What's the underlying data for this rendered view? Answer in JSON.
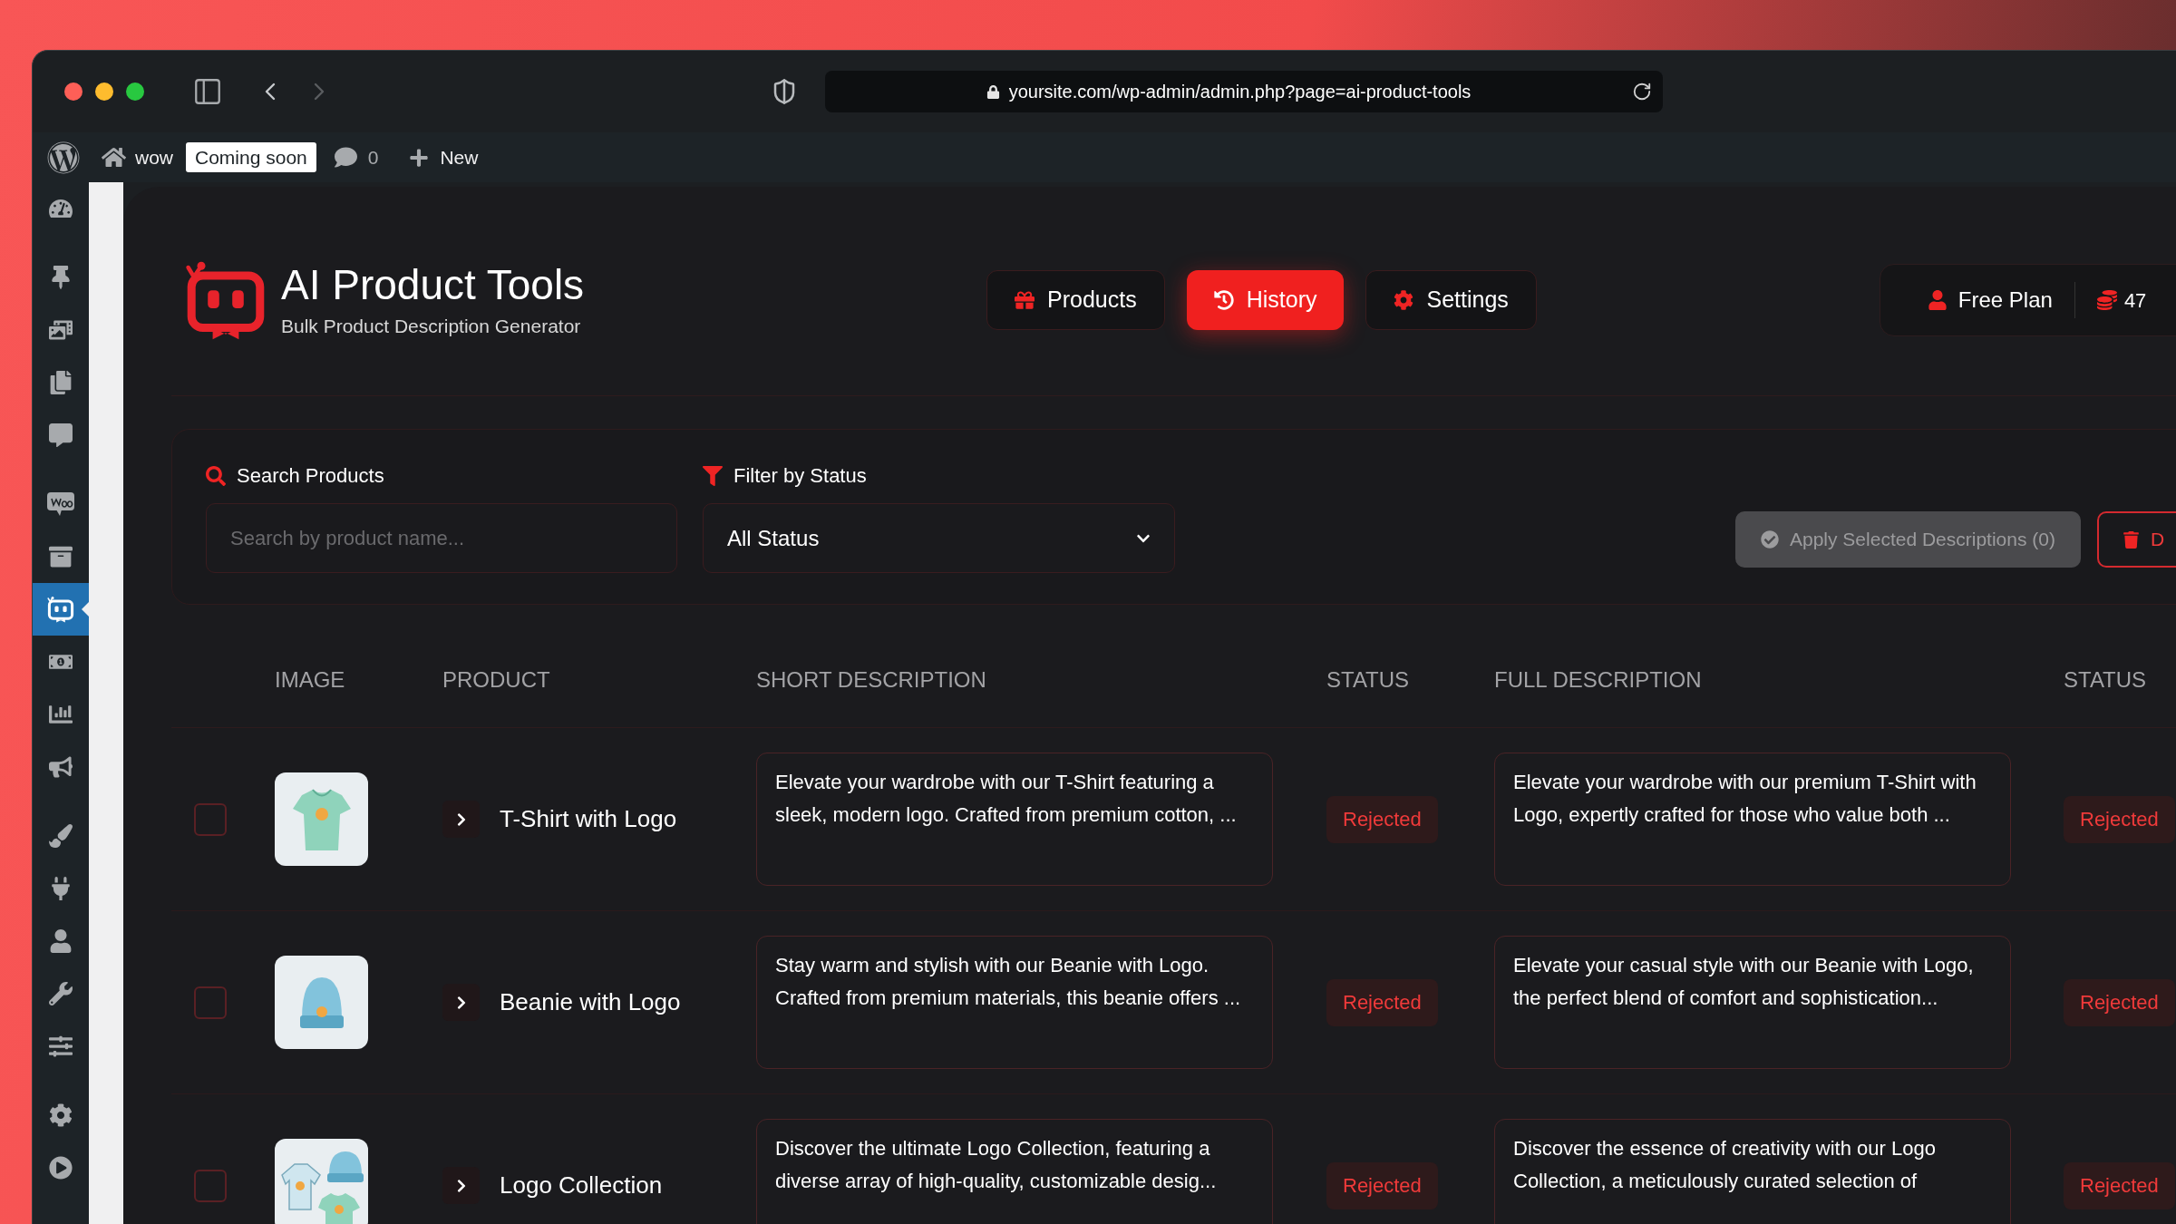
{
  "browser": {
    "url": "yoursite.com/wp-admin/admin.php?page=ai-product-tools"
  },
  "admin_bar": {
    "site_name": "wow",
    "badge": "Coming soon",
    "comments": "0",
    "new_label": "New"
  },
  "sidebar": {
    "groups": [
      {
        "items": [
          {
            "kind": "dashboard",
            "selected": false
          }
        ]
      },
      {
        "items": [
          {
            "kind": "pin",
            "selected": false
          },
          {
            "kind": "media",
            "selected": false
          },
          {
            "kind": "pages",
            "selected": false
          },
          {
            "kind": "comments",
            "selected": false
          }
        ]
      },
      {
        "items": [
          {
            "kind": "woo",
            "selected": false
          },
          {
            "kind": "archive",
            "selected": false
          },
          {
            "kind": "robot",
            "selected": true
          },
          {
            "kind": "money",
            "selected": false
          },
          {
            "kind": "chart",
            "selected": false
          },
          {
            "kind": "megaphone",
            "selected": false
          }
        ]
      },
      {
        "items": [
          {
            "kind": "brush",
            "selected": false
          },
          {
            "kind": "plug",
            "selected": false
          },
          {
            "kind": "user",
            "selected": false
          },
          {
            "kind": "wrench",
            "selected": false
          },
          {
            "kind": "sliders",
            "selected": false
          }
        ]
      },
      {
        "items": [
          {
            "kind": "gear",
            "selected": false
          },
          {
            "kind": "play",
            "selected": false
          }
        ]
      }
    ]
  },
  "app": {
    "title": "AI Product Tools",
    "subtitle": "Bulk Product Description Generator",
    "tabs": [
      {
        "label": "Products",
        "kind": "gift",
        "selected": false
      },
      {
        "label": "History",
        "kind": "history",
        "selected": true
      },
      {
        "label": "Settings",
        "kind": "gear",
        "selected": false
      }
    ],
    "plan": {
      "label": "Free Plan",
      "credits": "47"
    }
  },
  "filters": {
    "search_label": "Search Products",
    "placeholder": "Search by product name...",
    "status_label": "Filter by Status",
    "status_value": "All Status",
    "apply_button": {
      "label": "Apply Selected Descriptions (0)",
      "disabled": true
    },
    "delete_button": {
      "label": "D"
    }
  },
  "table": {
    "columns": [
      "IMAGE",
      "PRODUCT",
      "SHORT DESCRIPTION",
      "STATUS",
      "FULL DESCRIPTION",
      "STATUS"
    ],
    "rows": [
      {
        "checked": false,
        "expanded": false,
        "product": "T-Shirt with Logo",
        "short_description": "Elevate your wardrobe with our T-Shirt featuring a sleek, modern logo. Crafted from premium cotton, ...",
        "short_status": "Rejected",
        "full_description": "Elevate your wardrobe with our premium T-Shirt with Logo, expertly crafted for those who value both ...",
        "full_status": "Rejected"
      },
      {
        "checked": false,
        "expanded": false,
        "product": "Beanie with Logo",
        "short_description": "Stay warm and stylish with our Beanie with Logo. Crafted from premium materials, this beanie offers ...",
        "short_status": "Rejected",
        "full_description": "Elevate your casual style with our Beanie with Logo, the perfect blend of comfort and sophistication...",
        "full_status": "Rejected"
      },
      {
        "checked": false,
        "expanded": false,
        "product": "Logo Collection",
        "short_description": "Discover the ultimate Logo Collection, featuring a diverse array of high-quality, customizable desig...",
        "short_status": "Rejected",
        "full_description": "Discover the essence of creativity with our Logo Collection, a meticulously curated selection of",
        "full_status": "Rejected"
      }
    ]
  }
}
